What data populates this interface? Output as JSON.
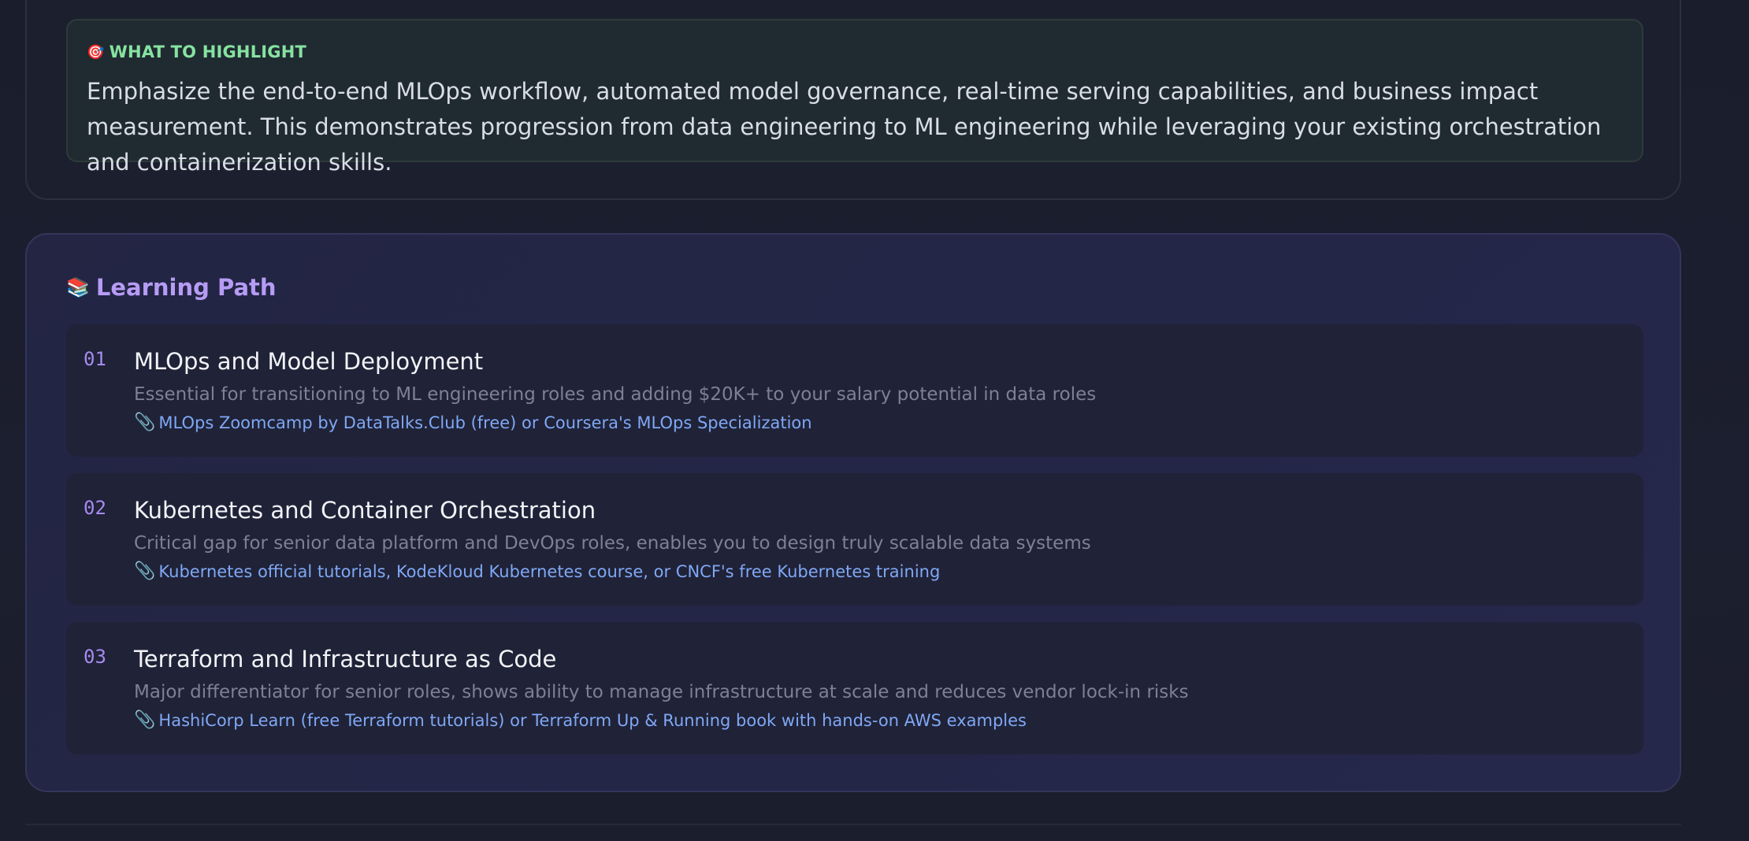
{
  "highlight": {
    "icon": "target-icon",
    "label": "WHAT TO HIGHLIGHT",
    "text": "Emphasize the end-to-end MLOps workflow, automated model governance, real-time serving capabilities, and business impact measurement. This demonstrates progression from data engineering to ML engineering while leveraging your existing orchestration and containerization skills."
  },
  "learning_path": {
    "icon": "books-icon",
    "title": "Learning Path",
    "items": [
      {
        "number": "01",
        "title": "MLOps and Model Deployment",
        "description": "Essential for transitioning to ML engineering roles and adding $20K+ to your salary potential in data roles",
        "resource": "MLOps Zoomcamp by DataTalks.Club (free) or Coursera's MLOps Specialization"
      },
      {
        "number": "02",
        "title": "Kubernetes and Container Orchestration",
        "description": "Critical gap for senior data platform and DevOps roles, enables you to design truly scalable data systems",
        "resource": "Kubernetes official tutorials, KodeKloud Kubernetes course, or CNCF's free Kubernetes training"
      },
      {
        "number": "03",
        "title": "Terraform and Infrastructure as Code",
        "description": "Major differentiator for senior roles, shows ability to manage infrastructure at scale and reduces vendor lock-in risks",
        "resource": "HashiCorp Learn (free Terraform tutorials) or Terraform Up & Running book with hands-on AWS examples"
      }
    ]
  },
  "colors": {
    "highlight_label": "#86e3a0",
    "learning_title": "#b69cf5",
    "resource_link": "#7fa8f5"
  }
}
